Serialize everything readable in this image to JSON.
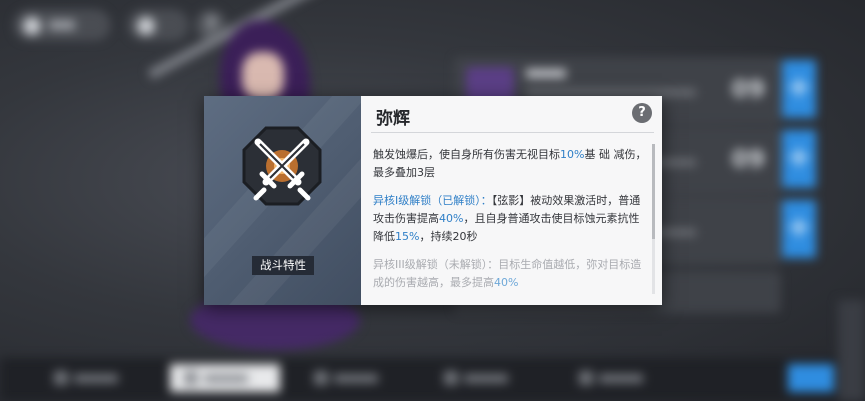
{
  "modal": {
    "title": "弥辉",
    "category_label": "战斗特性",
    "help_icon": "?",
    "paragraph1": {
      "a": "触发蚀爆后，使自身所有伤害无视目标",
      "b": "10%",
      "c": "基 础 减伤，最多叠加3层"
    },
    "paragraph2": {
      "head": "异核I级解锁（已解锁）：",
      "a": "【弦影】被动效果激活时，普通攻击伤害提高",
      "b": "40%",
      "c": "，且自身普通攻击使目标蚀元素抗性降低",
      "d": "15%",
      "e": "，持续20秒"
    },
    "paragraph3": {
      "a": "异核III级解锁（未解锁）：目标生命值越低，弥对目标造成的伤害越高，最多提高",
      "b": "40%"
    }
  },
  "background": {
    "help_icon": "?",
    "card_levels": [
      "09",
      "09"
    ],
    "plus_icon": "+"
  },
  "colors": {
    "accent_blue": "#2f7fc7",
    "panel_right": "#f7f7f8",
    "panel_left": "#5e6d82"
  }
}
